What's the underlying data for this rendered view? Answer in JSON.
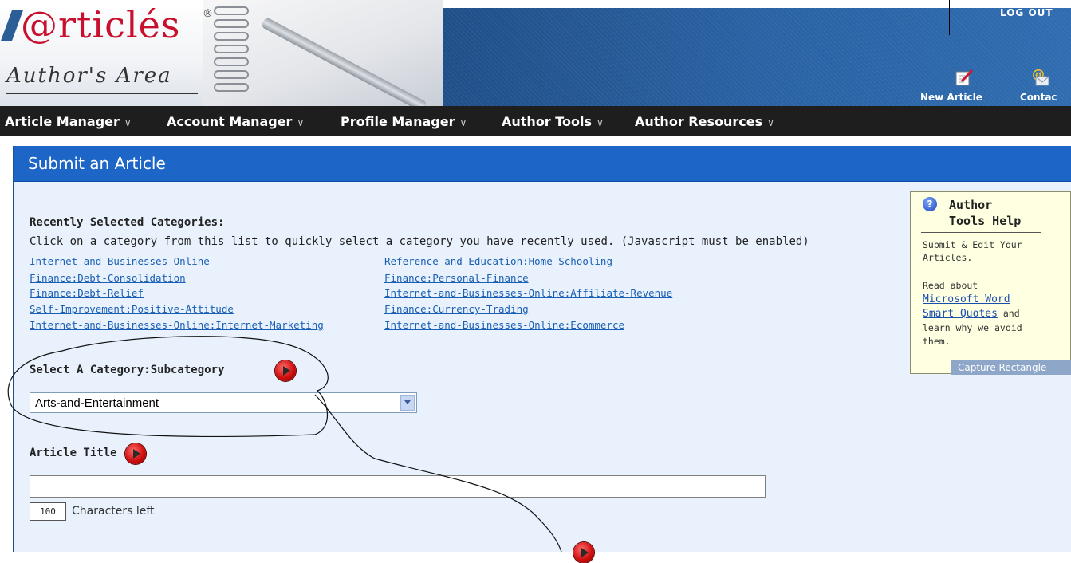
{
  "header": {
    "logo_text": "@rticlés",
    "logo_mark": "®",
    "subtitle": "Author's Area",
    "logout_label": "LOG OUT",
    "icons": [
      {
        "name": "new-article",
        "label": "New Article",
        "icon": "notepad-pen-icon"
      },
      {
        "name": "contact",
        "label": "Contac",
        "icon": "at-envelope-icon"
      }
    ]
  },
  "nav": {
    "items": [
      {
        "label": "Article Manager"
      },
      {
        "label": "Account Manager"
      },
      {
        "label": "Profile Manager"
      },
      {
        "label": "Author Tools"
      },
      {
        "label": "Author Resources"
      }
    ],
    "chevron": "∨"
  },
  "panel": {
    "title": "Submit an Article",
    "recent_heading": "Recently Selected Categories:",
    "recent_instructions": "Click on a category from this list to quickly select a category you have recently used. (Javascript must be enabled)",
    "recent_left": [
      "Internet-and-Businesses-Online",
      "Finance:Debt-Consolidation",
      "Finance:Debt-Relief",
      "Self-Improvement:Positive-Attitude",
      "Internet-and-Businesses-Online:Internet-Marketing"
    ],
    "recent_right": [
      "Reference-and-Education:Home-Schooling",
      "Finance:Personal-Finance",
      "Internet-and-Businesses-Online:Affiliate-Revenue",
      "Finance:Currency-Trading",
      "Internet-and-Businesses-Online:Ecommerce"
    ],
    "category_label": "Select A Category:Subcategory",
    "category_value": "Arts-and-Entertainment",
    "article_title_label": "Article Title",
    "article_title_value": "",
    "chars_left_count": "100",
    "chars_left_label": "Characters left"
  },
  "help": {
    "title_line1": "Author",
    "title_line2": "Tools Help",
    "line1": "Submit & Edit Your",
    "line2": "Articles.",
    "line3": "Read about",
    "link1": "Microsoft Word",
    "link2": "Smart Quotes",
    "after_link": " and",
    "line4": "learn why we avoid",
    "line5": "them.",
    "capture_badge": "Capture Rectangle"
  },
  "colors": {
    "panel_bg": "#e8f1fc",
    "title_bar": "#1d66c8",
    "nav_bg": "#1e1e1e",
    "link": "#1a5fb4",
    "help_bg": "#ffffe1"
  }
}
